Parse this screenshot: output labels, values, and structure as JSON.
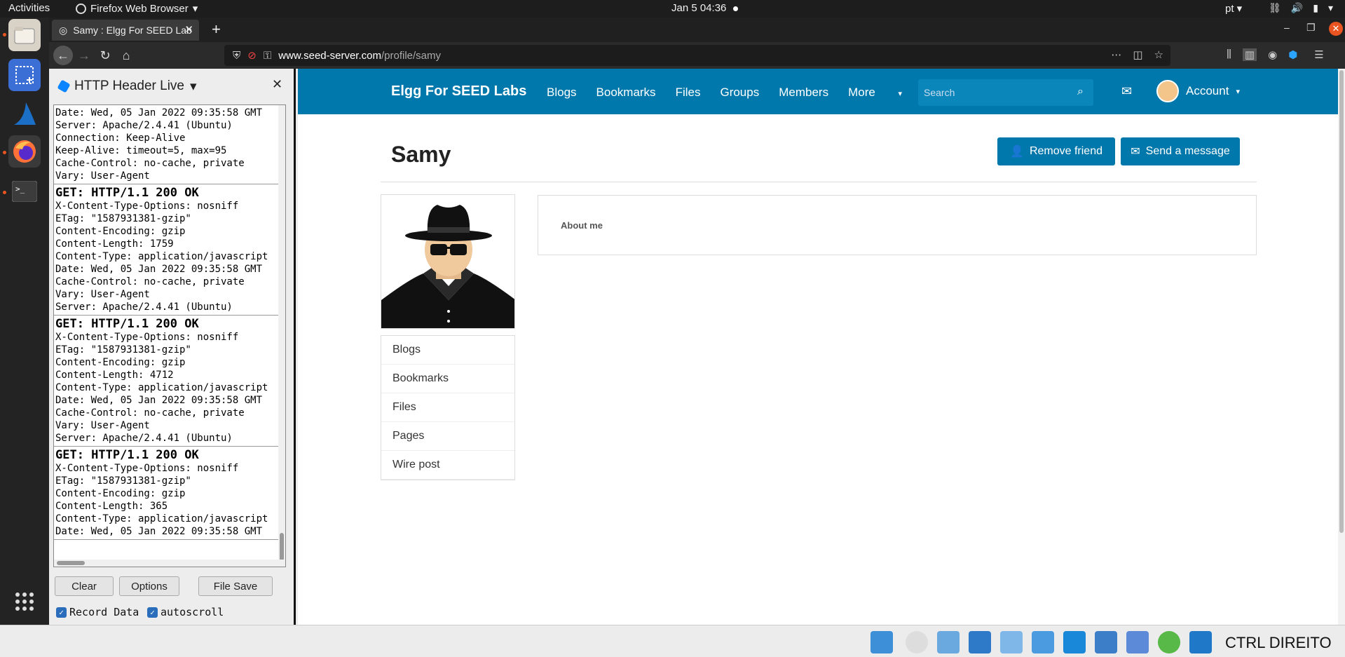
{
  "topbar": {
    "activities": "Activities",
    "app_name": "Firefox Web Browser",
    "clock": "Jan 5  04:36",
    "lang": "pt"
  },
  "dock": {
    "items": [
      "files-icon",
      "screenshot-icon",
      "wireshark-icon",
      "firefox-icon",
      "terminal-icon",
      "apps-grid-icon"
    ]
  },
  "browser": {
    "tab_title": "Samy : Elgg For SEED Lab",
    "url_host": "www.seed-server.com",
    "url_path": "/profile/samy"
  },
  "sidebar": {
    "title": "HTTP Header Live",
    "entries": [
      {
        "status": "",
        "lines": "Date: Wed, 05 Jan 2022 09:35:58 GMT\nServer: Apache/2.4.41 (Ubuntu)\nConnection: Keep-Alive\nKeep-Alive: timeout=5, max=95\nCache-Control: no-cache, private\nVary: User-Agent"
      },
      {
        "status": "GET: HTTP/1.1 200 OK",
        "lines": "X-Content-Type-Options: nosniff\nETag: \"1587931381-gzip\"\nContent-Encoding: gzip\nContent-Length: 1759\nContent-Type: application/javascript\nDate: Wed, 05 Jan 2022 09:35:58 GMT\nCache-Control: no-cache, private\nVary: User-Agent\nServer: Apache/2.4.41 (Ubuntu)"
      },
      {
        "status": "GET: HTTP/1.1 200 OK",
        "lines": "X-Content-Type-Options: nosniff\nETag: \"1587931381-gzip\"\nContent-Encoding: gzip\nContent-Length: 4712\nContent-Type: application/javascript\nDate: Wed, 05 Jan 2022 09:35:58 GMT\nCache-Control: no-cache, private\nVary: User-Agent\nServer: Apache/2.4.41 (Ubuntu)"
      },
      {
        "status": "GET: HTTP/1.1 200 OK",
        "lines": "X-Content-Type-Options: nosniff\nETag: \"1587931381-gzip\"\nContent-Encoding: gzip\nContent-Length: 365\nContent-Type: application/javascript\nDate: Wed, 05 Jan 2022 09:35:58 GMT"
      }
    ],
    "buttons": {
      "clear": "Clear",
      "options": "Options",
      "file_save": "File Save"
    },
    "checkboxes": {
      "record": "Record Data",
      "autoscroll": "autoscroll"
    }
  },
  "elgg": {
    "brand": "Elgg For SEED Labs",
    "menu": [
      "Blogs",
      "Bookmarks",
      "Files",
      "Groups",
      "Members",
      "More"
    ],
    "search_placeholder": "Search",
    "account": "Account",
    "profile_name": "Samy",
    "remove_friend": "Remove friend",
    "send_message": "Send a message",
    "owner_menu": [
      "Blogs",
      "Bookmarks",
      "Files",
      "Pages",
      "Wire post"
    ],
    "about_label": "About me"
  },
  "vmbar": {
    "host_key": "CTRL DIREITO"
  }
}
